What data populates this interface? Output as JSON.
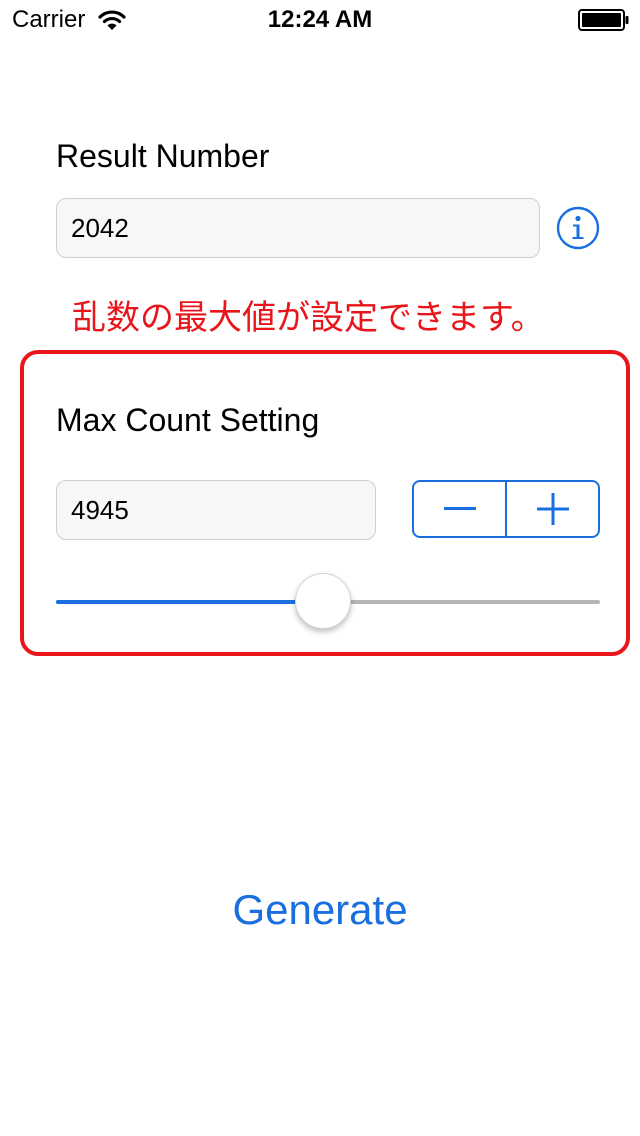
{
  "status_bar": {
    "carrier": "Carrier",
    "time": "12:24 AM",
    "wifi_icon": "wifi-icon",
    "battery_icon": "battery-full-icon"
  },
  "result": {
    "label": "Result Number",
    "value": "2042",
    "info_icon": "info-icon"
  },
  "annotation": {
    "text": "乱数の最大値が設定できます。",
    "color": "#e8151b"
  },
  "max_setting": {
    "label": "Max Count Setting",
    "value": "4945",
    "stepper": {
      "minus_icon": "minus-icon",
      "plus_icon": "plus-icon"
    },
    "slider_fraction": 0.49
  },
  "generate_label": "Generate",
  "colors": {
    "accent": "#1a6fe0",
    "annotation": "#e8151b",
    "field_background": "#f7f7f7"
  }
}
